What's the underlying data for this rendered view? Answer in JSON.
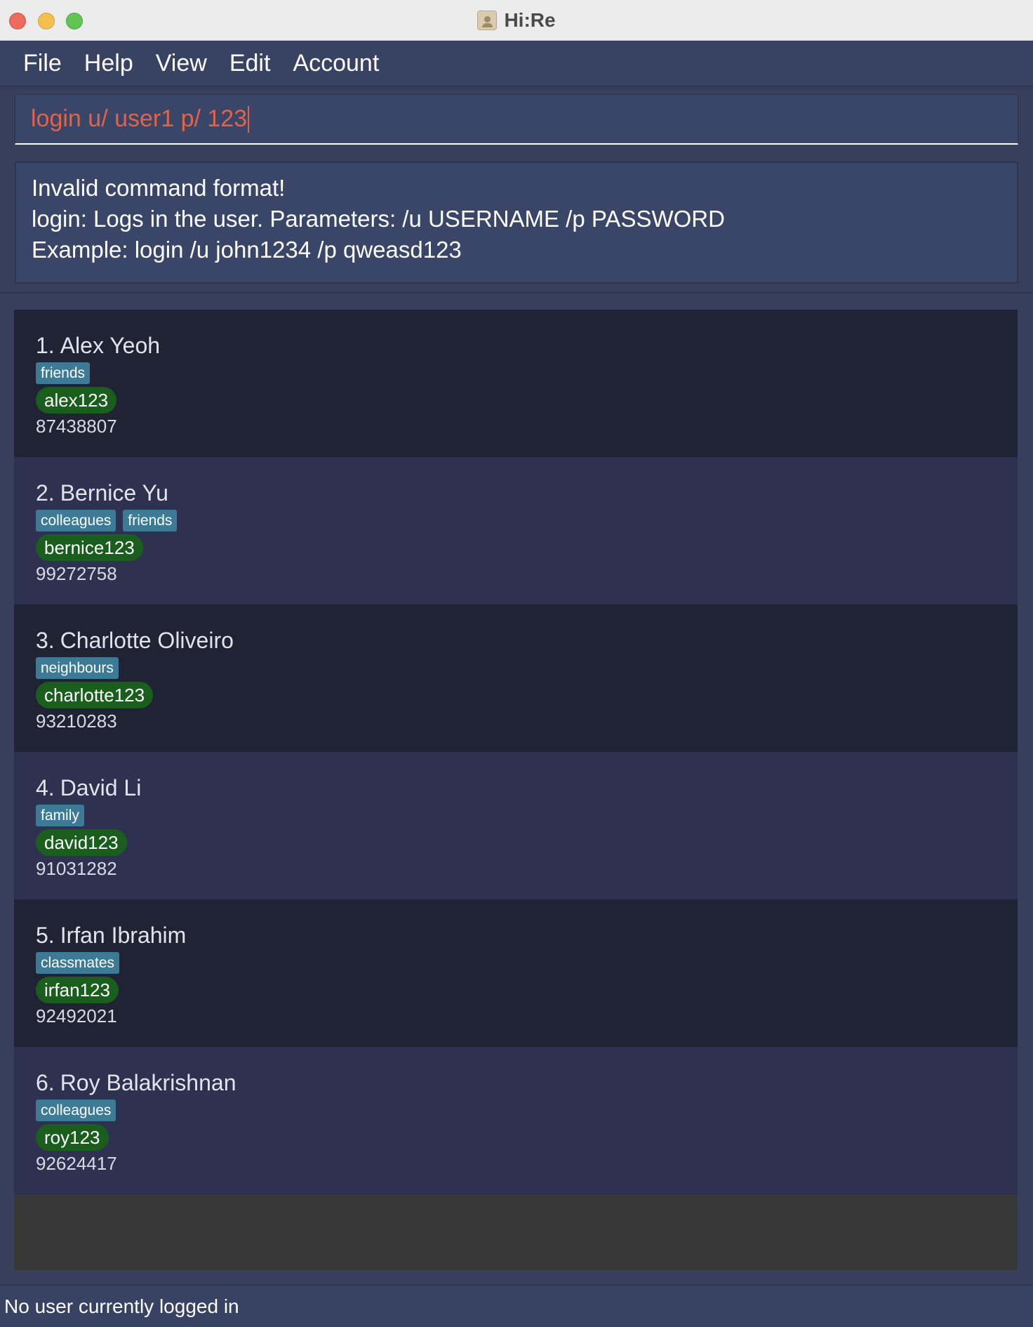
{
  "window": {
    "title": "Hi:Re"
  },
  "menu": [
    "File",
    "Help",
    "View",
    "Edit",
    "Account"
  ],
  "command": {
    "value": "login u/ user1 p/ 123"
  },
  "result": {
    "lines": [
      "Invalid command format!",
      "login: Logs in the user. Parameters: /u USERNAME /p PASSWORD",
      "Example: login /u john1234 /p qweasd123"
    ]
  },
  "people": [
    {
      "index": "1.",
      "name": "Alex Yeoh",
      "tags": [
        "friends"
      ],
      "username": "alex123",
      "phone": "87438807"
    },
    {
      "index": "2.",
      "name": "Bernice Yu",
      "tags": [
        "colleagues",
        "friends"
      ],
      "username": "bernice123",
      "phone": "99272758"
    },
    {
      "index": "3.",
      "name": "Charlotte Oliveiro",
      "tags": [
        "neighbours"
      ],
      "username": "charlotte123",
      "phone": "93210283"
    },
    {
      "index": "4.",
      "name": "David Li",
      "tags": [
        "family"
      ],
      "username": "david123",
      "phone": "91031282"
    },
    {
      "index": "5.",
      "name": "Irfan Ibrahim",
      "tags": [
        "classmates"
      ],
      "username": "irfan123",
      "phone": "92492021"
    },
    {
      "index": "6.",
      "name": "Roy Balakrishnan",
      "tags": [
        "colleagues"
      ],
      "username": "roy123",
      "phone": "92624417"
    }
  ],
  "status": {
    "text": "No user currently logged in"
  },
  "colors": {
    "command_text": "#E0634B",
    "tag_bg": "#3C7A96",
    "username_bg": "#1A5E1E",
    "card_dark": "#1F2333",
    "card_light": "#2E3250"
  }
}
